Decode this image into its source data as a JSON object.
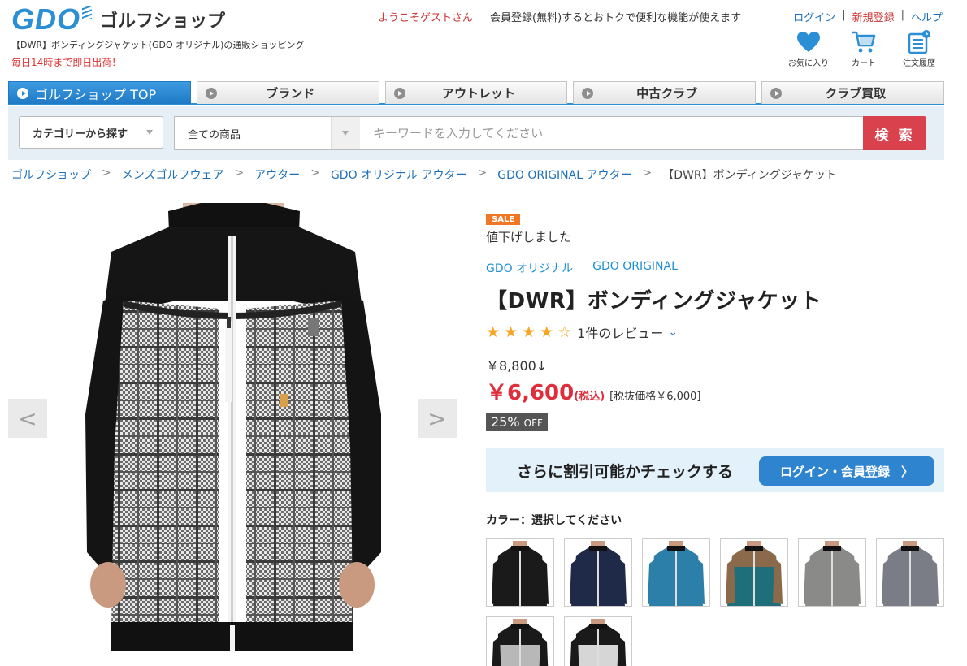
{
  "header": {
    "logo_gdo": "GDO",
    "logo_shop": "ゴルフショップ",
    "description": "【DWR】ボンディングジャケット(GDO オリジナル)の通販ショッピング",
    "shipping_note": "毎日14時まで即日出荷！",
    "welcome": "ようこそゲストさん",
    "member_note": "会員登録(無料)するとおトクで便利な機能が使えます",
    "links": {
      "login": "ログイン",
      "register": "新規登録",
      "help": "ヘルプ",
      "sep": "|"
    },
    "icons": [
      {
        "name": "heart-icon",
        "label": "お気に入り"
      },
      {
        "name": "cart-icon",
        "label": "カート"
      },
      {
        "name": "order-history-icon",
        "label": "注文履歴"
      }
    ]
  },
  "nav": {
    "tabs": [
      {
        "label": "ゴルフショップ TOP",
        "active": true
      },
      {
        "label": "ブランド"
      },
      {
        "label": "アウトレット"
      },
      {
        "label": "中古クラブ"
      },
      {
        "label": "クラブ買取"
      }
    ]
  },
  "search": {
    "category_button": "カテゴリーから探す",
    "scope": "全ての商品",
    "placeholder": "キーワードを入力してください",
    "button": "検 索"
  },
  "breadcrumb": {
    "items": [
      "ゴルフショップ",
      "メンズゴルフウェア",
      "アウター",
      "GDO オリジナル アウター",
      "GDO ORIGINAL アウター"
    ],
    "current": "【DWR】ボンディングジャケット",
    "sep": ">"
  },
  "gallery": {
    "prev": "<",
    "next": ">"
  },
  "product": {
    "sale_badge": "SALE",
    "price_down": "値下げしました",
    "brand_jp": "GDO オリジナル",
    "brand_en": "GDO ORIGINAL",
    "title": "【DWR】ボンディングジャケット",
    "rating": 4,
    "rating_max": 5,
    "stars": "★★★★☆",
    "review_count": "1件のレビュー",
    "old_price": "￥8,800↓",
    "price": "￥6,600",
    "tax_in": "(税込)",
    "tax_ex": "[税抜価格￥6,000]",
    "off_value": "25%",
    "off_unit": "OFF",
    "discount_check": "さらに割引可能かチェックする",
    "login_button": "ログイン・会員登録",
    "login_arrow": "〉",
    "color_label": "カラー：選択してください",
    "swatches": [
      {
        "name": "black",
        "body": "#1a1a1a",
        "accent": "#1a1a1a"
      },
      {
        "name": "navy",
        "body": "#1e2a48",
        "accent": "#1e2a48"
      },
      {
        "name": "blue",
        "body": "#2b7fa8",
        "accent": "#2b7fa8"
      },
      {
        "name": "brown-teal",
        "body": "#1f6f7a",
        "accent": "#8a6a4a"
      },
      {
        "name": "gray",
        "body": "#8a8a88",
        "accent": "#8a8a88"
      },
      {
        "name": "charcoal",
        "body": "#7a7d85",
        "accent": "#7a7d85"
      },
      {
        "name": "black-glen-check",
        "body": "#b8b8b8",
        "accent": "#1a1a1a"
      },
      {
        "name": "black-plaid",
        "body": "#d6d6d6",
        "accent": "#1a1a1a"
      }
    ]
  },
  "colors": {
    "brand_blue": "#2b8fd6",
    "sale_orange": "#f07824",
    "price_red": "#e02d3c",
    "search_red": "#d9414c"
  }
}
